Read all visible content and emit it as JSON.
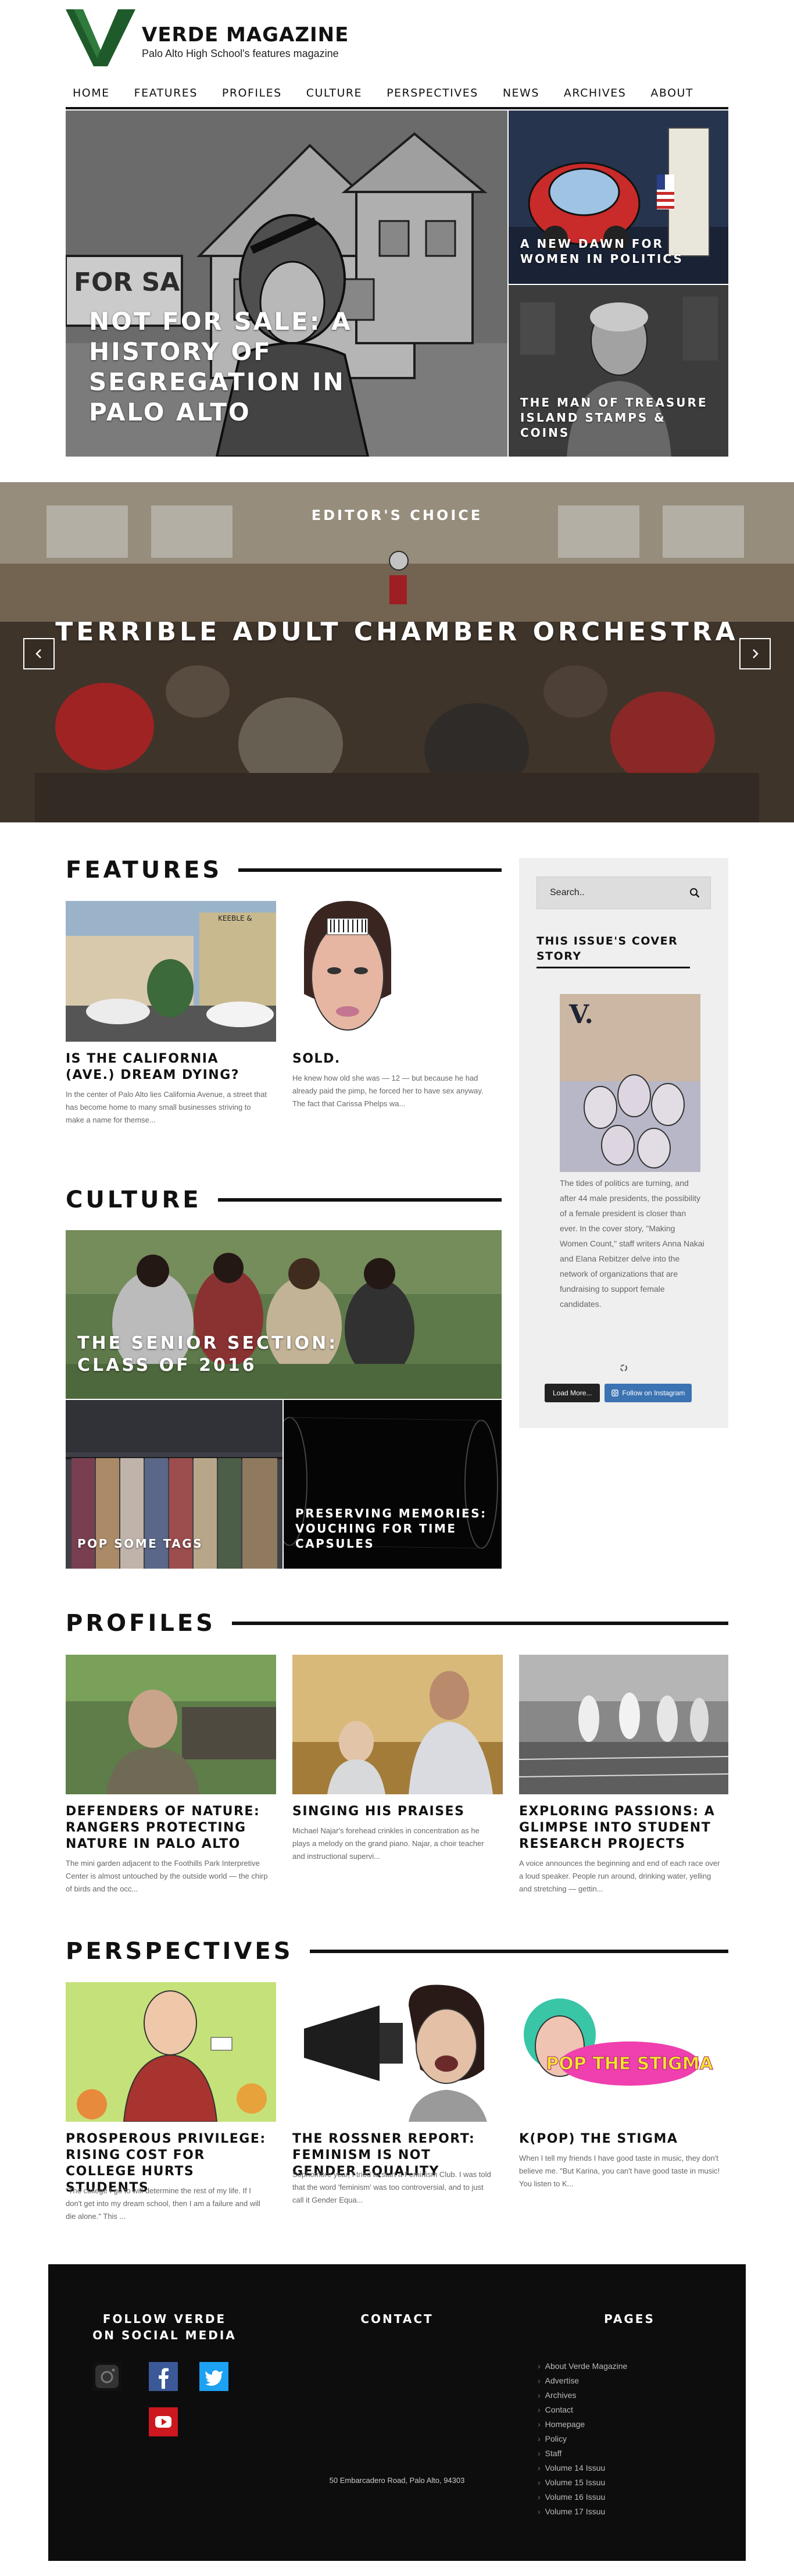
{
  "brand": {
    "title": "VERDE MAGAZINE",
    "subtitle": "Palo Alto High School's features magazine",
    "color": "#1f5a2b"
  },
  "nav": [
    "HOME",
    "FEATURES",
    "PROFILES",
    "CULTURE",
    "PERSPECTIVES",
    "NEWS",
    "ARCHIVES",
    "ABOUT"
  ],
  "hero": {
    "main": {
      "title": "NOT FOR SALE: A HISTORY OF SEGREGATION IN PALO ALTO"
    },
    "side1": {
      "title": "A NEW DAWN FOR WOMEN IN POLITICS"
    },
    "side2": {
      "title": "THE MAN OF TREASURE ISLAND STAMPS & COINS"
    }
  },
  "slider": {
    "kicker": "EDITOR'S CHOICE",
    "title": "TERRIBLE ADULT CHAMBER ORCHESTRA"
  },
  "features": {
    "heading": "FEATURES",
    "cards": [
      {
        "title": "IS THE CALIFORNIA (AVE.) DREAM DYING?",
        "excerpt": "In the center of Palo Alto lies California Avenue, a street that has become home to many small businesses striving to make a name for themse..."
      },
      {
        "title": "SOLD.",
        "excerpt": "He knew how old she was — 12 — but because he had already paid the pimp, he forced her to have sex anyway. The fact that Carissa Phelps wa..."
      }
    ]
  },
  "sidebar": {
    "search_placeholder": "Search..",
    "cover_title": "THIS ISSUE'S COVER STORY",
    "cover_text": "The tides of politics are turning, and after 44 male presidents, the possibility of a female president is closer than ever. In the cover story, \"Making Women Count,\" staff writers Anna Nakai and Elana Rebitzer delve into the network of organizations that are fundraising to support female candidates.",
    "cover_letter": "V.",
    "load_more": "Load More...",
    "follow": "Follow on Instagram"
  },
  "culture": {
    "heading": "CULTURE",
    "tiles": [
      {
        "title": "THE SENIOR SECTION: CLASS OF 2016"
      },
      {
        "title": "POP SOME TAGS"
      },
      {
        "title": "PRESERVING MEMORIES: VOUCHING FOR TIME CAPSULES"
      }
    ]
  },
  "profiles": {
    "heading": "PROFILES",
    "cards": [
      {
        "title": "DEFENDERS OF NATURE: RANGERS PROTECTING NATURE IN PALO ALTO",
        "excerpt": "The mini garden adjacent to the Foothills Park Interpretive Center is almost untouched by the outside world — the chirp of birds and the occ..."
      },
      {
        "title": "SINGING HIS PRAISES",
        "excerpt": "Michael Najar's forehead crinkles in concentration as he plays a melody on the grand piano. Najar, a choir teacher and instructional supervi..."
      },
      {
        "title": "EXPLORING PASSIONS: A GLIMPSE INTO STUDENT RESEARCH PROJECTS",
        "excerpt": "A voice announces the beginning and end of each race over a loud speaker. People run around, drinking water, yelling and stretching — gettin..."
      }
    ]
  },
  "perspectives": {
    "heading": "PERSPECTIVES",
    "cards": [
      {
        "title": "PROSPEROUS PRIVILEGE: RISING COST FOR COLLEGE HURTS STUDENTS",
        "excerpt": "\"The college I go to will determine the rest of my life. If I don't get into my dream school, then I am a failure and will die alone.\" This ..."
      },
      {
        "title": "THE ROSSNER REPORT: FEMINISM IS NOT GENDER EQUALITY",
        "excerpt": "Sophomore year, I tried to start a Feminism Club. I was told that the word 'feminism' was too controversial, and to just call it Gender Equa..."
      },
      {
        "title": "K(POP) THE STIGMA",
        "excerpt": "When I tell my friends I have good taste in music, they don't believe me. \"But Karina, you can't have good taste in music! You listen to K..."
      }
    ],
    "kpop_art_text": "POP THE STIGMA"
  },
  "footer": {
    "social_heading": "FOLLOW VERDE ON SOCIAL MEDIA",
    "contact_heading": "CONTACT",
    "pages_heading": "PAGES",
    "address": "50 Embarcadero Road, Palo Alto, 94303",
    "pages": [
      "About Verde Magazine",
      "Advertise",
      "Archives",
      "Contact",
      "Homepage",
      "Policy",
      "Staff",
      "Volume 14 Issuu",
      "Volume 15 Issuu",
      "Volume 16 Issuu",
      "Volume 17 Issuu"
    ]
  }
}
